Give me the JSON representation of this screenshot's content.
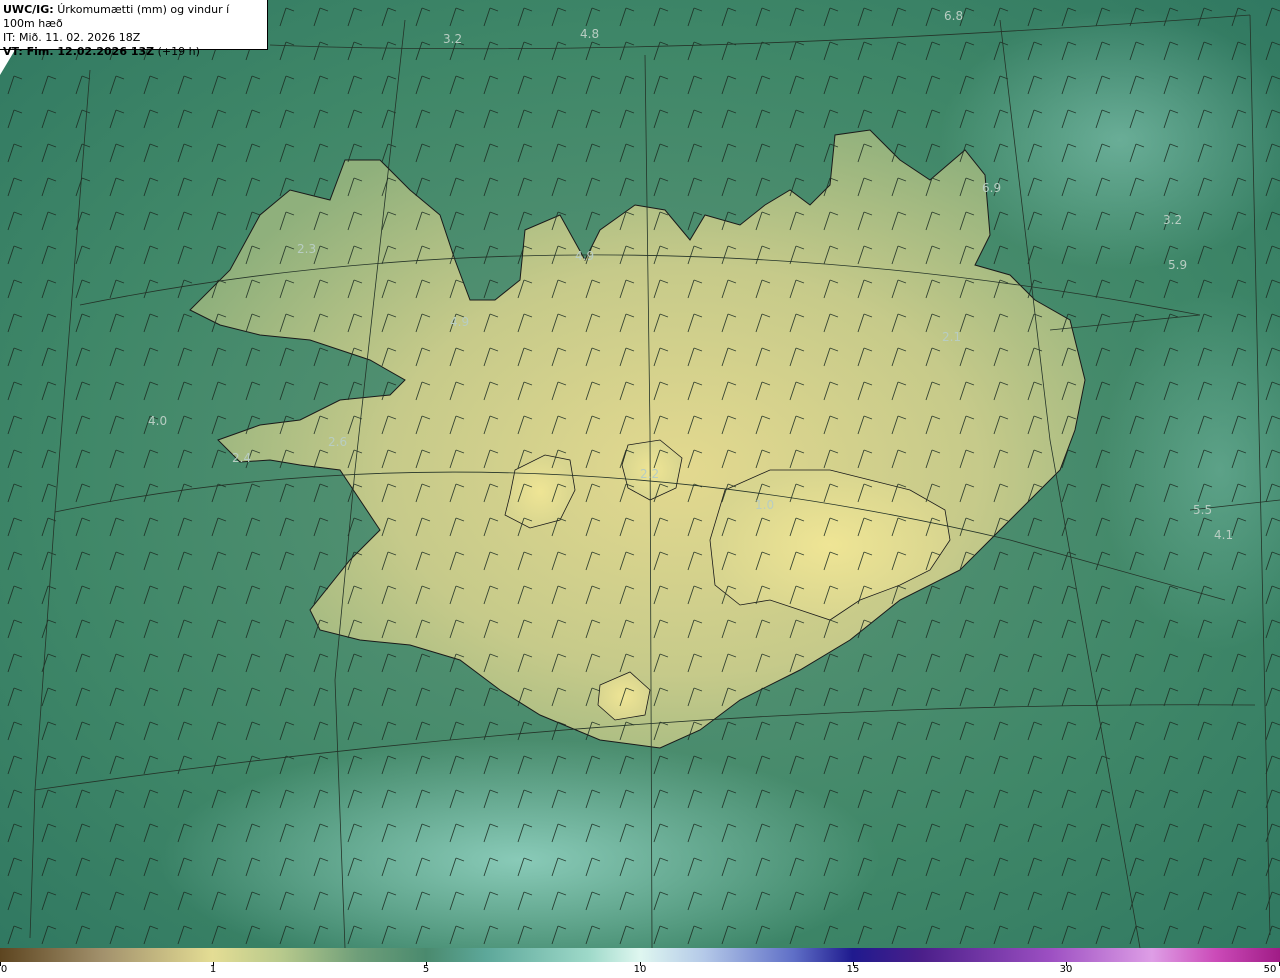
{
  "header": {
    "model_label": "UWC/IG:",
    "title": "Úrkomumætti (mm) og vindur í 100m hæð",
    "init_time": "IT: Mið. 11. 02. 2026 18Z",
    "valid_label": "VT: Fim. 12.02.2026 13Z",
    "valid_offset": "(+19 h)"
  },
  "map_values": [
    "3.2",
    "4.8",
    "6.8",
    "6.9",
    "3.2",
    "5.9",
    "4.9",
    "4.9",
    "2.3",
    "4.0",
    "2.6",
    "2.4",
    "2.1",
    "2.2",
    "1.0",
    "5.5",
    "4.1"
  ],
  "colorbar": {
    "ticks": [
      "0",
      "1",
      "5",
      "10",
      "15",
      "30",
      "50"
    ]
  },
  "colors": {
    "sea_dark": "#2f7a63",
    "sea_light": "#8fd1c0",
    "land_low": "#a6bd86",
    "land_high": "#eae194",
    "outline": "#1a1a1a"
  }
}
